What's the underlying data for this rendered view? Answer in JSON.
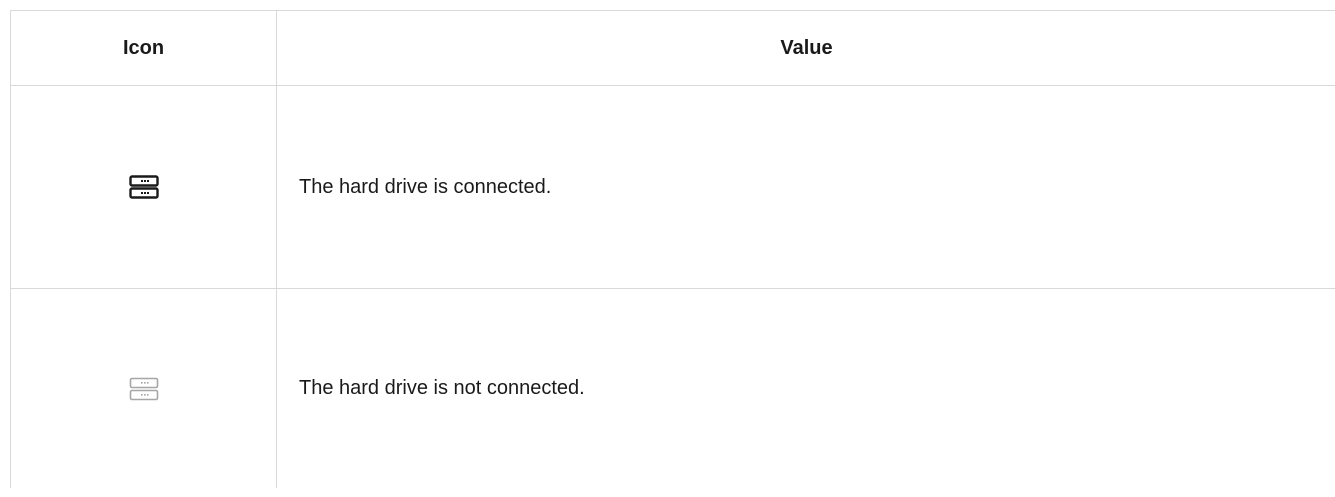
{
  "table": {
    "headers": {
      "icon": "Icon",
      "value": "Value"
    },
    "rows": [
      {
        "icon": "hard-drive-connected-icon",
        "icon_color": "#1a1a1a",
        "value": "The hard drive is connected."
      },
      {
        "icon": "hard-drive-disconnected-icon",
        "icon_color": "#a6a6a6",
        "value": "The hard drive is not connected."
      }
    ]
  }
}
